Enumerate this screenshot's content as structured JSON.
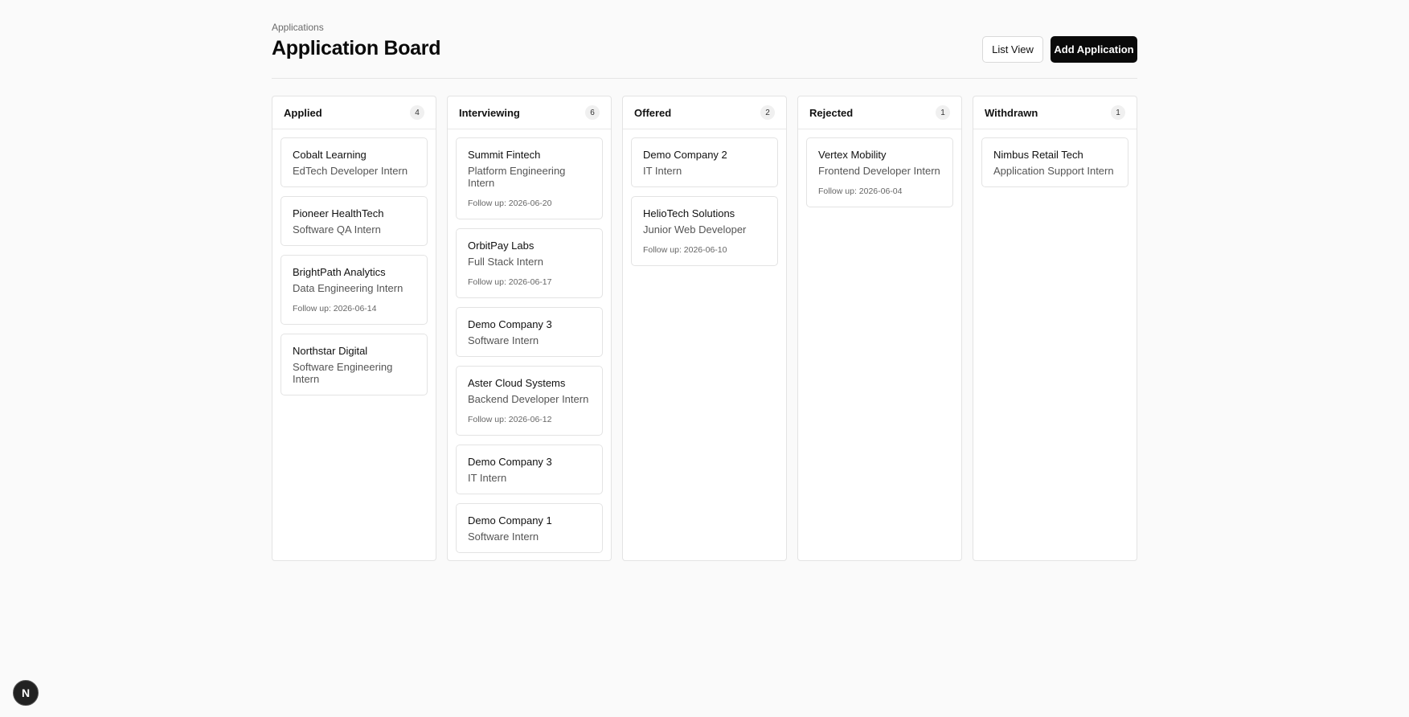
{
  "breadcrumb": "Applications",
  "title": "Application Board",
  "actions": {
    "list_view": "List View",
    "add_application": "Add Application"
  },
  "columns": [
    {
      "title": "Applied",
      "count": "4",
      "cards": [
        {
          "company": "Cobalt Learning",
          "role": "EdTech Developer Intern",
          "follow_up": ""
        },
        {
          "company": "Pioneer HealthTech",
          "role": "Software QA Intern",
          "follow_up": ""
        },
        {
          "company": "BrightPath Analytics",
          "role": "Data Engineering Intern",
          "follow_up": "Follow up: 2026-06-14"
        },
        {
          "company": "Northstar Digital",
          "role": "Software Engineering Intern",
          "follow_up": ""
        }
      ]
    },
    {
      "title": "Interviewing",
      "count": "6",
      "cards": [
        {
          "company": "Summit Fintech",
          "role": "Platform Engineering Intern",
          "follow_up": "Follow up: 2026-06-20"
        },
        {
          "company": "OrbitPay Labs",
          "role": "Full Stack Intern",
          "follow_up": "Follow up: 2026-06-17"
        },
        {
          "company": "Demo Company 3",
          "role": "Software Intern",
          "follow_up": ""
        },
        {
          "company": "Aster Cloud Systems",
          "role": "Backend Developer Intern",
          "follow_up": "Follow up: 2026-06-12"
        },
        {
          "company": "Demo Company 3",
          "role": "IT Intern",
          "follow_up": ""
        },
        {
          "company": "Demo Company 1",
          "role": "Software Intern",
          "follow_up": ""
        }
      ]
    },
    {
      "title": "Offered",
      "count": "2",
      "cards": [
        {
          "company": "Demo Company 2",
          "role": "IT Intern",
          "follow_up": ""
        },
        {
          "company": "HelioTech Solutions",
          "role": "Junior Web Developer",
          "follow_up": "Follow up: 2026-06-10"
        }
      ]
    },
    {
      "title": "Rejected",
      "count": "1",
      "cards": [
        {
          "company": "Vertex Mobility",
          "role": "Frontend Developer Intern",
          "follow_up": "Follow up: 2026-06-04"
        }
      ]
    },
    {
      "title": "Withdrawn",
      "count": "1",
      "cards": [
        {
          "company": "Nimbus Retail Tech",
          "role": "Application Support Intern",
          "follow_up": ""
        }
      ]
    }
  ],
  "dev_badge": {
    "letter": "N",
    "icon": "nextjs-logo-icon"
  }
}
